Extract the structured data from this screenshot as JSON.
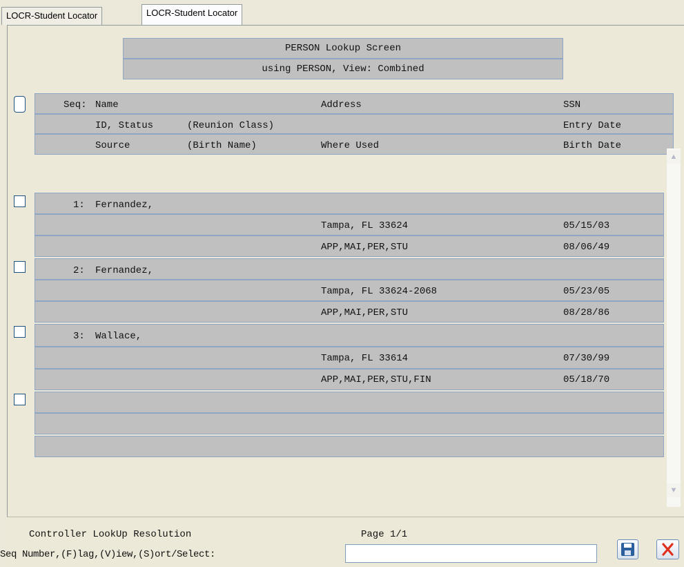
{
  "tabs": [
    "LOCR-Student Locator",
    "LOCR-Student Locator"
  ],
  "title": {
    "line1": "PERSON Lookup Screen",
    "line2": "using PERSON, View: Combined"
  },
  "header": {
    "row1": {
      "seq": "Seq:",
      "name": "Name",
      "address": "Address",
      "ssn": "SSN"
    },
    "row2": {
      "id_status": "ID, Status",
      "reunion": "(Reunion Class)",
      "entry_date": "Entry Date"
    },
    "row3": {
      "source": "Source",
      "birth_name": "(Birth Name)",
      "where_used": "Where Used",
      "birth_date": "Birth Date"
    }
  },
  "records": [
    {
      "seq": "1:",
      "name": "Fernandez,",
      "city": "Tampa, FL 33624",
      "entry_date": "05/15/03",
      "where_used": "APP,MAI,PER,STU",
      "birth_date": "08/06/49"
    },
    {
      "seq": "2:",
      "name": "Fernandez,",
      "city": "Tampa, FL 33624-2068",
      "entry_date": "05/23/05",
      "where_used": "APP,MAI,PER,STU",
      "birth_date": "08/28/86"
    },
    {
      "seq": "3:",
      "name": "Wallace,",
      "city": "Tampa, FL 33614",
      "entry_date": "07/30/99",
      "where_used": "APP,MAI,PER,STU,FIN",
      "birth_date": "05/18/70"
    }
  ],
  "footer": {
    "status": "Controller LookUp Resolution",
    "page": "Page 1/1",
    "prompt": "Seq Number,(F)lag,(V)iew,(S)ort/Select:",
    "input_value": ""
  },
  "icons": {
    "save": "save-icon",
    "close": "close-icon",
    "scroll_up": "chevron-up-icon",
    "scroll_down": "chevron-down-icon"
  },
  "colors": {
    "grid_fill": "#c0c0c0",
    "grid_line": "#8ea5c5",
    "close_red": "#e0301e",
    "save_blue": "#2c5f9e"
  }
}
